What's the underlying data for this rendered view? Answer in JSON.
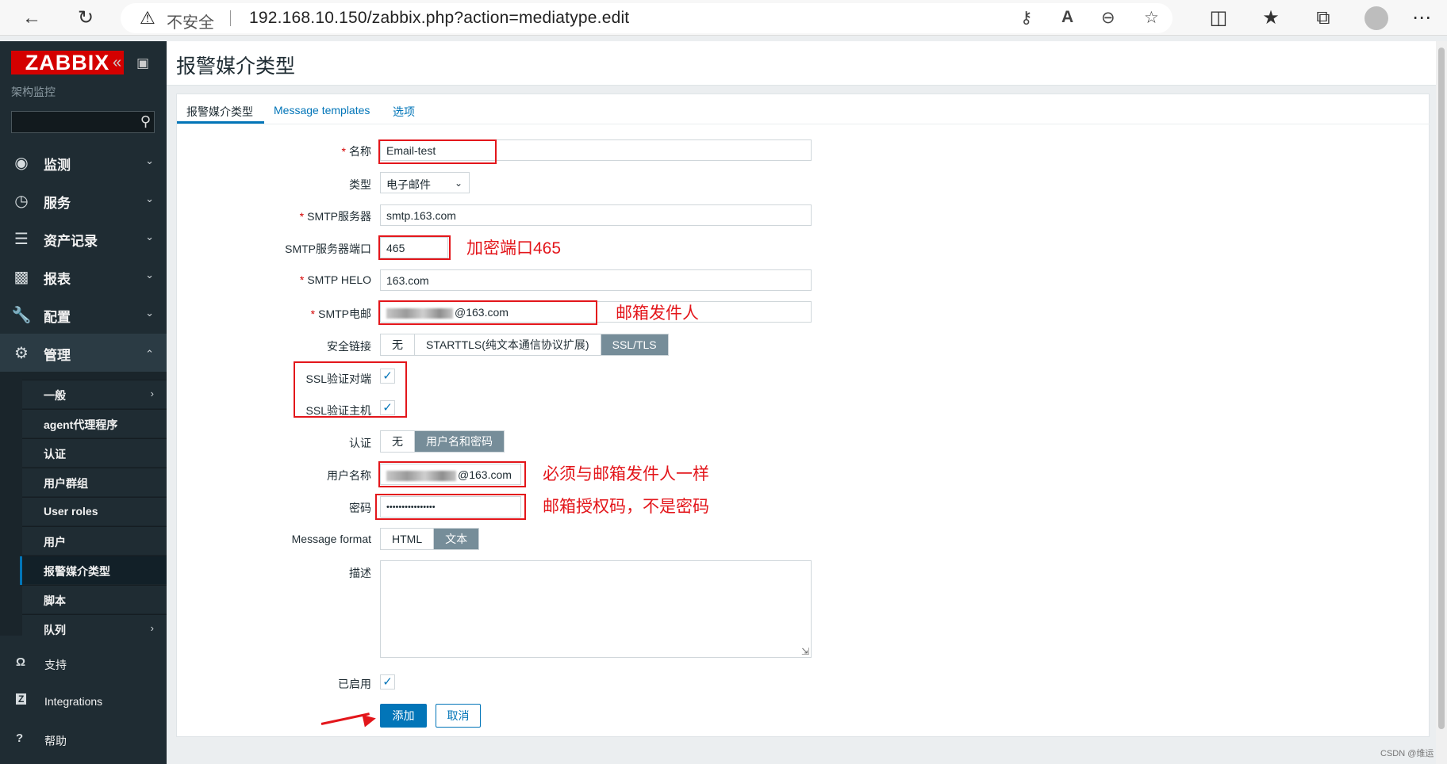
{
  "browser": {
    "security_label": "不安全",
    "url": "192.168.10.150/zabbix.php?action=mediatype.edit"
  },
  "sidebar": {
    "logo": "ZABBIX",
    "subtitle": "架构监控",
    "search": {
      "value": "",
      "placeholder": ""
    },
    "menu": [
      {
        "label": "监测",
        "icon": "eye-icon"
      },
      {
        "label": "服务",
        "icon": "clock-icon"
      },
      {
        "label": "资产记录",
        "icon": "list-icon"
      },
      {
        "label": "报表",
        "icon": "bar-chart-icon"
      },
      {
        "label": "配置",
        "icon": "wrench-icon"
      },
      {
        "label": "管理",
        "icon": "gear-icon"
      }
    ],
    "submenu": [
      {
        "label": "一般"
      },
      {
        "label": "agent代理程序"
      },
      {
        "label": "认证"
      },
      {
        "label": "用户群组"
      },
      {
        "label": "User roles"
      },
      {
        "label": "用户"
      },
      {
        "label": "报警媒介类型"
      },
      {
        "label": "脚本"
      },
      {
        "label": "队列"
      }
    ],
    "footer": [
      {
        "label": "支持",
        "icon": "headset-icon"
      },
      {
        "label": "Integrations",
        "icon": "z-icon"
      },
      {
        "label": "帮助",
        "icon": "question-icon"
      }
    ]
  },
  "page": {
    "title": "报警媒介类型",
    "tabs": [
      "报警媒介类型",
      "Message templates",
      "选项"
    ]
  },
  "form": {
    "name": {
      "label": "名称",
      "value": "Email-test"
    },
    "type": {
      "label": "类型",
      "value": "电子邮件"
    },
    "smtp_server": {
      "label": "SMTP服务器",
      "value": "smtp.163.com"
    },
    "smtp_port": {
      "label": "SMTP服务器端口",
      "value": "465"
    },
    "smtp_helo": {
      "label": "SMTP HELO",
      "value": "163.com"
    },
    "smtp_email": {
      "label": "SMTP电邮",
      "value": "@163.com"
    },
    "security": {
      "label": "安全链接",
      "options": [
        "无",
        "STARTTLS(纯文本通信协议扩展)",
        "SSL/TLS"
      ],
      "selected": "SSL/TLS"
    },
    "ssl_verify_peer": {
      "label": "SSL验证对端",
      "checked": true
    },
    "ssl_verify_host": {
      "label": "SSL验证主机",
      "checked": true
    },
    "auth": {
      "label": "认证",
      "options": [
        "无",
        "用户名和密码"
      ],
      "selected": "用户名和密码"
    },
    "username": {
      "label": "用户名称",
      "value": "@163.com"
    },
    "password": {
      "label": "密码",
      "value": "••••••••••••••••"
    },
    "message_format": {
      "label": "Message format",
      "options": [
        "HTML",
        "文本"
      ],
      "selected": "文本"
    },
    "description": {
      "label": "描述",
      "value": ""
    },
    "enabled": {
      "label": "已启用",
      "checked": true
    },
    "add_button": "添加",
    "cancel_button": "取消"
  },
  "annotations": {
    "port": "加密端口465",
    "email": "邮箱发件人",
    "username": "必须与邮箱发件人一样",
    "password": "邮箱授权码，不是密码",
    "color": "#e3161b"
  },
  "watermark": "CSDN @维运",
  "colors": {
    "brand": "#d40000",
    "accent": "#0275b8",
    "sidebar": "#1f2c33",
    "segment_on": "#768d99"
  }
}
